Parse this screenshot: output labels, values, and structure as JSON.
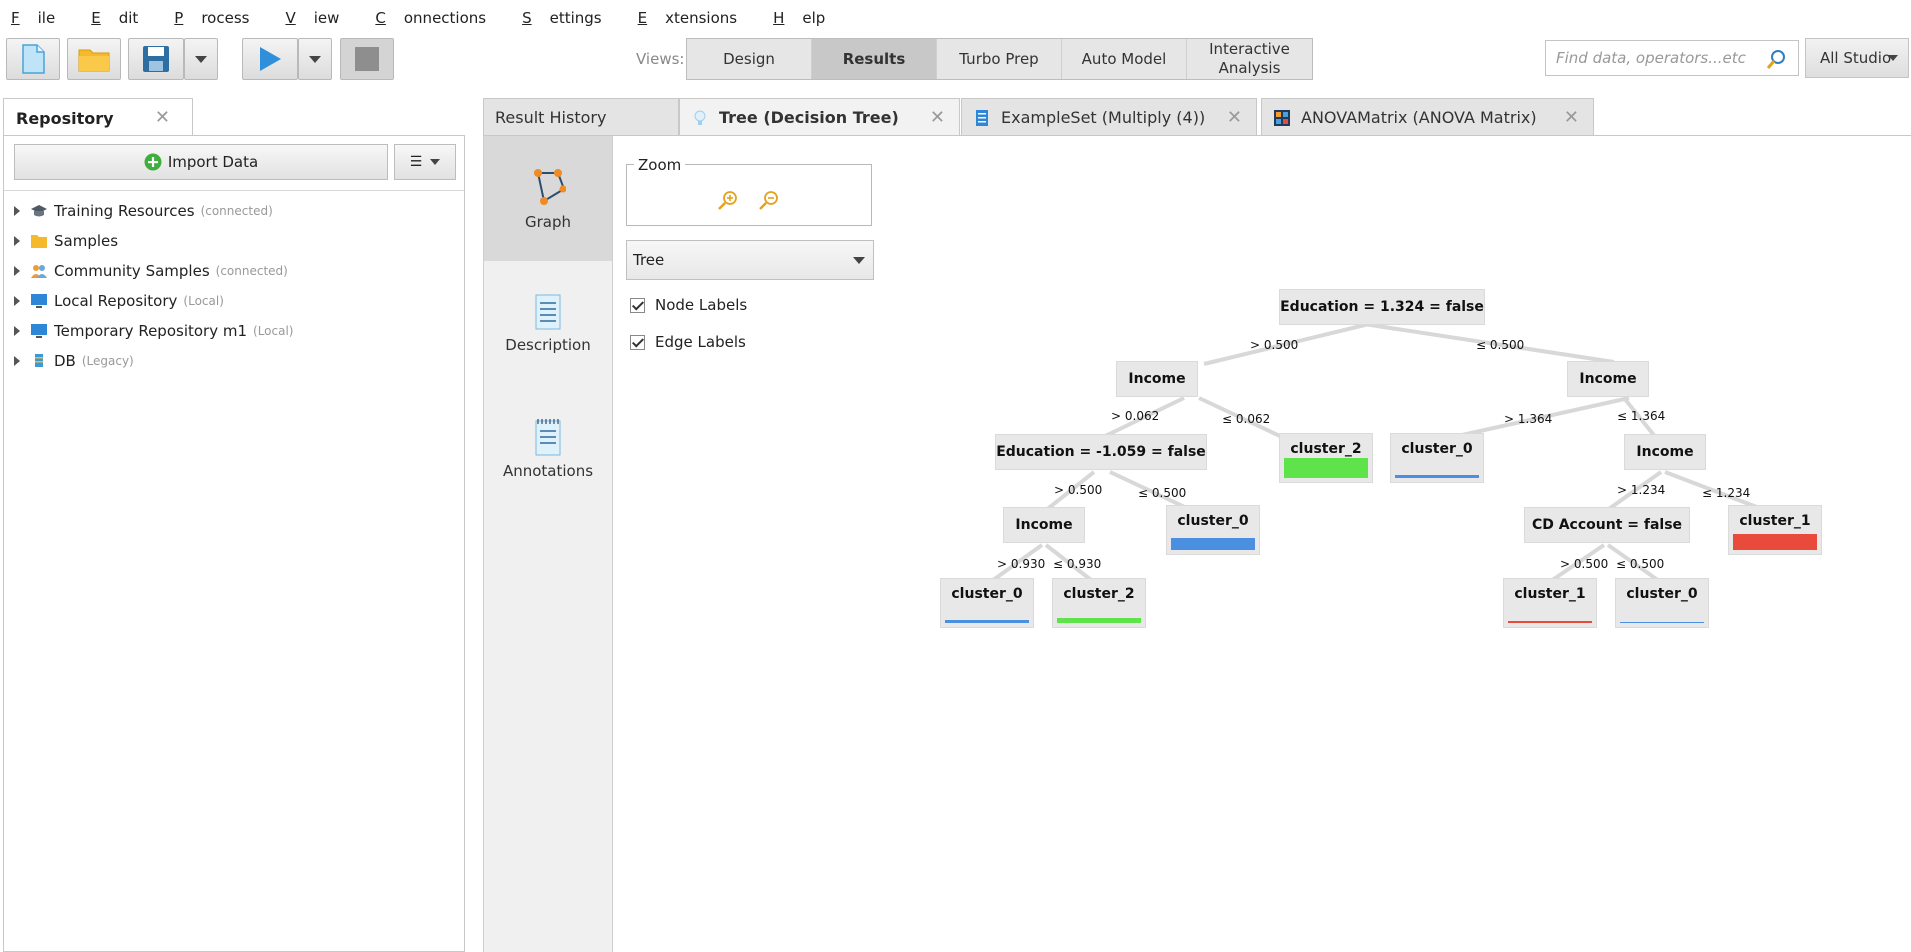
{
  "menu": [
    {
      "u": "F",
      "rest": "ile"
    },
    {
      "u": "E",
      "rest": "dit"
    },
    {
      "u": "P",
      "rest": "rocess"
    },
    {
      "u": "V",
      "rest": "iew"
    },
    {
      "u": "C",
      "rest": "onnections"
    },
    {
      "u": "S",
      "rest": "ettings"
    },
    {
      "u": "E",
      "rest": "xtensions"
    },
    {
      "u": "H",
      "rest": "elp"
    }
  ],
  "toolbar": {
    "views_label": "Views:",
    "views": [
      "Design",
      "Results",
      "Turbo Prep",
      "Auto Model",
      "Interactive Analysis"
    ],
    "active_view": "Results",
    "search_placeholder": "Find data, operators...etc",
    "all_studio": "All Studio"
  },
  "repository": {
    "tab_title": "Repository",
    "import_label": "Import Data",
    "items": [
      {
        "label": "Training Resources",
        "tag": "(connected)"
      },
      {
        "label": "Samples",
        "tag": ""
      },
      {
        "label": "Community Samples",
        "tag": "(connected)"
      },
      {
        "label": "Local Repository",
        "tag": "(Local)"
      },
      {
        "label": "Temporary Repository m1",
        "tag": "(Local)"
      },
      {
        "label": "DB",
        "tag": "(Legacy)"
      }
    ]
  },
  "result_tabs": [
    {
      "label": "Result History"
    },
    {
      "label": "Tree (Decision Tree)"
    },
    {
      "label": "ExampleSet (Multiply (4))"
    },
    {
      "label": "ANOVAMatrix (ANOVA Matrix)"
    }
  ],
  "sidenav": [
    "Graph",
    "Description",
    "Annotations"
  ],
  "controls": {
    "zoom_title": "Zoom",
    "layout_select": "Tree",
    "node_labels": "Node Labels",
    "edge_labels": "Edge Labels"
  },
  "tree": {
    "nodes": {
      "root": "Education = 1.324 = false",
      "income_l": "Income",
      "income_r": "Income",
      "edu2": "Education = -1.059 = false",
      "income_ll": "Income",
      "income_rr": "Income",
      "cd": "CD Account = false"
    },
    "leaves": {
      "leaf_a": "cluster_2",
      "leaf_b": "cluster_0",
      "leaf_c": "cluster_0",
      "leaf_d": "cluster_0",
      "leaf_e": "cluster_2",
      "leaf_f": "cluster_1",
      "leaf_g": "cluster_1",
      "leaf_h": "cluster_0"
    },
    "edges": {
      "e1": "> 0.500",
      "e2": "≤ 0.500",
      "e3": "> 0.062",
      "e4": "≤ 0.062",
      "e5": "> 1.364",
      "e6": "≤ 1.364",
      "e7": "> 0.500",
      "e8": "≤ 0.500",
      "e9": "> 1.234",
      "e10": "≤ 1.234",
      "e11": "> 0.930",
      "e12": "≤ 0.930",
      "e13": "> 0.500",
      "e14": "≤ 0.500"
    },
    "colors": {
      "cluster_0": "#4a8fe0",
      "cluster_1": "#e84a3c",
      "cluster_2": "#5ee34a"
    }
  }
}
